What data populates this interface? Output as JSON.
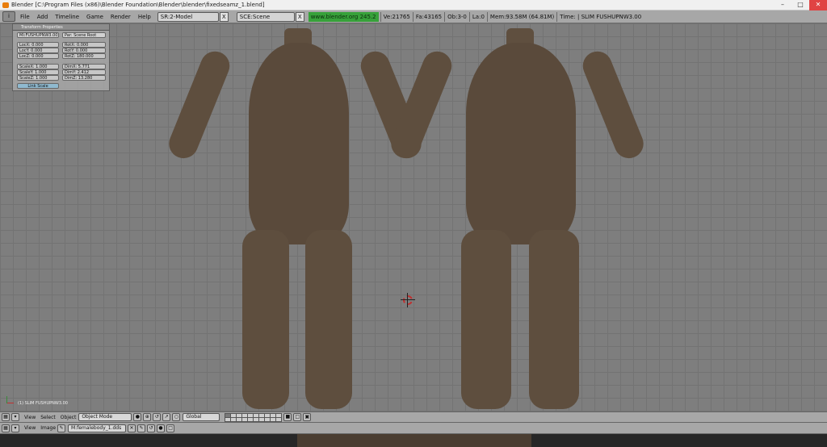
{
  "window": {
    "title": "Blender [C:\\Program Files (x86)\\Blender Foundation\\Blender\\blender\\fixedseamz_1.blend]",
    "minimize_glyph": "–",
    "maximize_glyph": "□",
    "close_glyph": "✕"
  },
  "topbar": {
    "editor_btn": "i",
    "menu": [
      "File",
      "Add",
      "Timeline",
      "Game",
      "Render",
      "Help"
    ],
    "screen": "SR:2-Model",
    "scene": "SCE:Scene",
    "close_glyph": "X",
    "url": "www.blender.org 245.2",
    "stats": [
      "Ve:21765",
      "Fa:43165",
      "Ob:3-0",
      "La:0",
      "Mem:93.58M (64.81M)",
      "Time: | SLIM FUSHUPNW3.00"
    ]
  },
  "transform_panel": {
    "title": "Transform Properties",
    "name": "MI:FUSHUPNW3.00",
    "par": "Par: Scene Root",
    "loc": [
      "LocX: 0.000",
      "LocY: 0.000",
      "LocZ: 0.000"
    ],
    "rot": [
      "RotX: 0.000",
      "RotY: 0.000",
      "RotZ: 180.000"
    ],
    "scale": [
      "ScaleX: 1.000",
      "ScaleY: 1.000",
      "ScaleZ: 1.000"
    ],
    "dim": [
      "DimX: 5.771",
      "DimY: 2.412",
      "DimZ: 13.280"
    ],
    "link_scale": "Link Scale"
  },
  "viewport": {
    "object_label": "(1) SLIM FUSHUPNW3.00"
  },
  "header3d": {
    "menu": [
      "View",
      "Select",
      "Object"
    ],
    "mode": "Object Mode",
    "orientation": "Global"
  },
  "header_image": {
    "menu": [
      "View",
      "Image"
    ],
    "image": "M:femalebody_1.dds"
  },
  "colors": {
    "url_green": "#37a13a",
    "grid": "#7e7e7e",
    "figure": "#5a4a3b",
    "cursor_red": "#c03030"
  }
}
